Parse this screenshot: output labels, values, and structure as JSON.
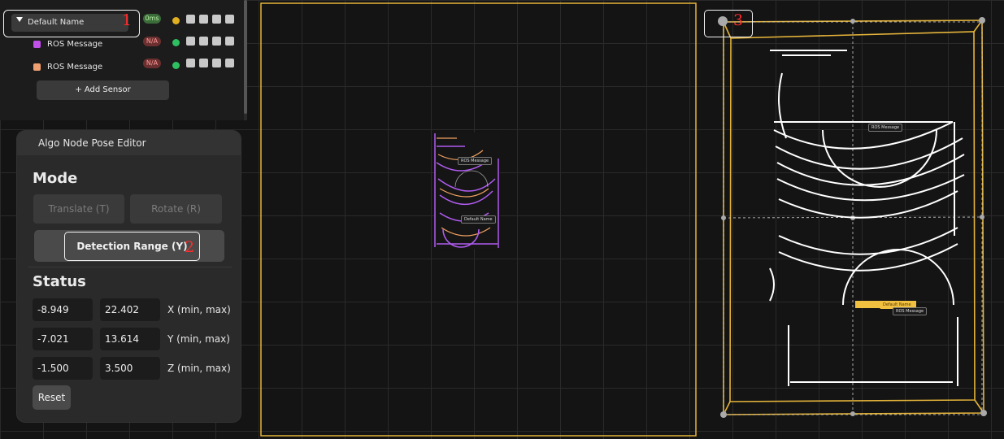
{
  "sensor_panel": {
    "root": {
      "name": "Default Name",
      "latency": "0ms",
      "status_color": "#e0b020"
    },
    "children": [
      {
        "name": "ROS Message",
        "latency": "N/A",
        "swatch_color": "#c050e8",
        "status_color": "#2ec060"
      },
      {
        "name": "ROS Message",
        "latency": "N/A",
        "swatch_color": "#f0a070",
        "status_color": "#2ec060"
      }
    ],
    "add_sensor_label": "+ Add Sensor"
  },
  "editor": {
    "title": "Algo Node Pose Editor",
    "mode_heading": "Mode",
    "translate_label": "Translate (T)",
    "rotate_label": "Rotate (R)",
    "detection_range_label": "Detection Range (Y)",
    "status_heading": "Status",
    "x": {
      "min": "-8.949",
      "max": "22.402",
      "label": "X (min, max)"
    },
    "y": {
      "min": "-7.021",
      "max": "13.614",
      "label": "Y (min, max)"
    },
    "z": {
      "min": "-1.500",
      "max": "3.500",
      "label": "Z (min, max)"
    },
    "reset_label": "Reset"
  },
  "annotations": {
    "one": "1",
    "two": "2",
    "three": "3"
  },
  "viewport_left": {
    "labels": {
      "ros": "ROS Message",
      "default": "Default Name"
    }
  },
  "viewport_right": {
    "labels": {
      "ros_top": "ROS Message",
      "default": "Default Name",
      "ros_bottom": "ROS Message"
    }
  },
  "colors": {
    "bbox_yellow": "#e5b43a",
    "accent_purple": "#b05cf0",
    "accent_orange": "#f0a060"
  }
}
